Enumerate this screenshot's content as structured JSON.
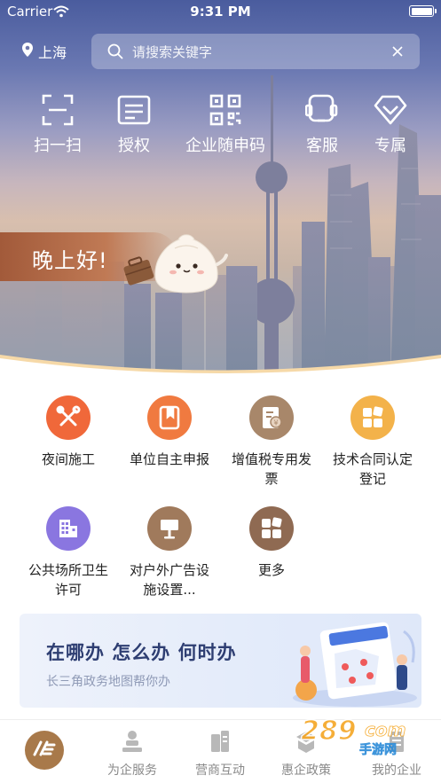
{
  "status": {
    "carrier": "Carrier",
    "time": "9:31 PM"
  },
  "header": {
    "location": "上海",
    "search_placeholder": "请搜索关键字"
  },
  "quick_actions": [
    {
      "label": "扫一扫",
      "icon": "scan-icon"
    },
    {
      "label": "授权",
      "icon": "authorize-icon"
    },
    {
      "label": "企业随申码",
      "icon": "qrcode-icon"
    },
    {
      "label": "客服",
      "icon": "customer-service-icon"
    },
    {
      "label": "专属",
      "icon": "diamond-icon"
    }
  ],
  "greeting": "晚上好!",
  "services": [
    {
      "label": "夜间施工",
      "icon": "tools-icon",
      "color": "#f0683a"
    },
    {
      "label": "单位自主申报",
      "icon": "bookmark-doc-icon",
      "color": "#f07a40"
    },
    {
      "label": "增值税专用发票",
      "icon": "invoice-icon",
      "color": "#a8876a"
    },
    {
      "label": "技术合同认定登记",
      "icon": "blocks-icon",
      "color": "#f3b24a"
    },
    {
      "label": "公共场所卫生许可",
      "icon": "building-icon",
      "color": "#8a76e0"
    },
    {
      "label": "对户外广告设施设置...",
      "icon": "billboard-icon",
      "color": "#a07a5c"
    },
    {
      "label": "更多",
      "icon": "more-grid-icon",
      "color": "#8f6a52"
    }
  ],
  "banner": {
    "title": "在哪办 怎么办 何时办",
    "subtitle": "长三角政务地图帮你办"
  },
  "tabs": [
    {
      "label": "",
      "icon": "home-logo-icon",
      "active": true
    },
    {
      "label": "为企服务",
      "icon": "service-icon"
    },
    {
      "label": "营商互动",
      "icon": "interaction-icon"
    },
    {
      "label": "惠企政策",
      "icon": "policy-icon"
    },
    {
      "label": "我的企业",
      "icon": "my-company-icon"
    }
  ],
  "colors": {
    "accent": "#a8794a",
    "banner_title": "#2e3e72"
  }
}
